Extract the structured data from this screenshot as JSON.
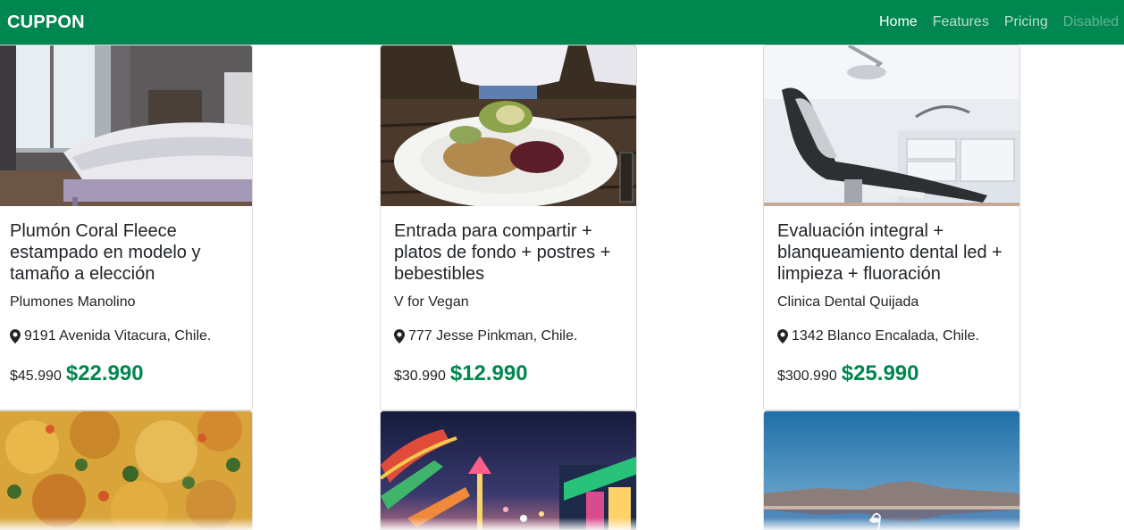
{
  "navbar": {
    "brand": "CUPPON",
    "links": [
      "Home",
      "Features",
      "Pricing",
      "Disabled"
    ]
  },
  "deals": [
    {
      "image": "bedroom-photo",
      "title": "Plumón Coral Fleece estampado en modelo y tamaño a elección",
      "merchant": "Plumones Manolino",
      "address": "9191 Avenida Vitacura, Chile.",
      "old_price": "$45.990",
      "new_price": "$22.990"
    },
    {
      "image": "vegan-dish-photo",
      "title": "Entrada para compartir + platos de fondo + postres + bebestibles",
      "merchant": "V for Vegan",
      "address": "777 Jesse Pinkman, Chile.",
      "old_price": "$30.990",
      "new_price": "$12.990"
    },
    {
      "image": "dental-chair-photo",
      "title": "Evaluación integral + blanqueamiento dental led + limpieza + fluoración",
      "merchant": "Clinica Dental Quijada",
      "address": "1342 Blanco Encalada, Chile.",
      "old_price": "$300.990",
      "new_price": "$25.990"
    },
    {
      "image": "food-closeup-photo"
    },
    {
      "image": "amusement-park-photo"
    },
    {
      "image": "salt-lake-flamingo-photo"
    }
  ],
  "colors": {
    "brand_green": "#00874f"
  },
  "icons": {
    "address": "map-marker-icon"
  }
}
